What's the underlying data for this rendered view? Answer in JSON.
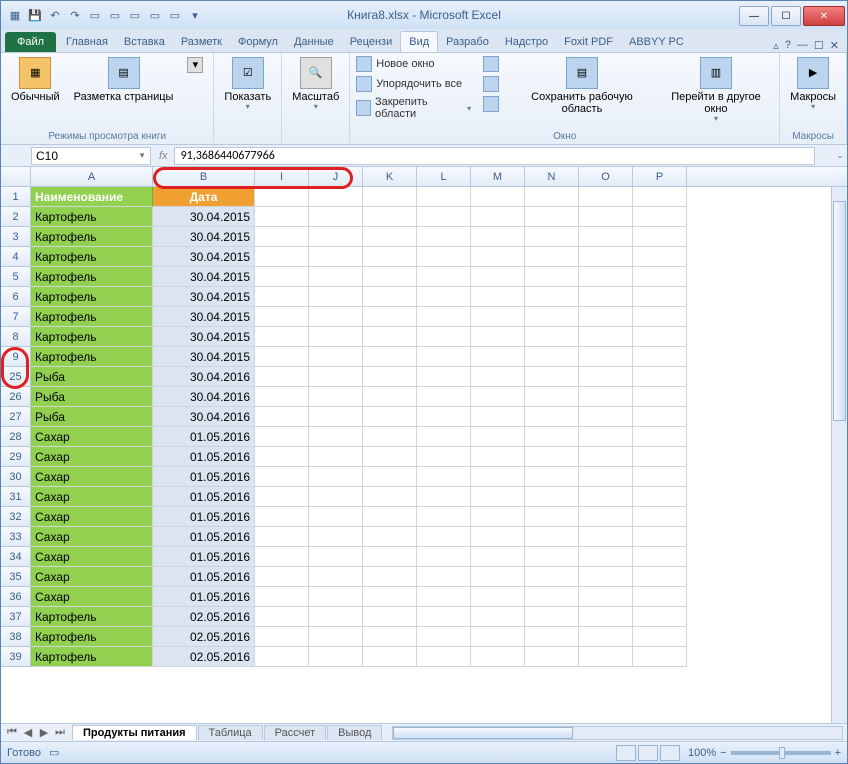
{
  "window": {
    "title": "Книга8.xlsx - Microsoft Excel"
  },
  "tabs": {
    "file": "Файл",
    "items": [
      "Главная",
      "Вставка",
      "Разметк",
      "Формул",
      "Данные",
      "Рецензи",
      "Вид",
      "Разрабо",
      "Надстро",
      "Foxit PDF",
      "ABBYY PC"
    ],
    "active_index": 6
  },
  "ribbon": {
    "group_views": {
      "label": "Режимы просмотра книги",
      "normal": "Обычный",
      "page_layout": "Разметка страницы",
      "more": ""
    },
    "group_show": {
      "btn": "Показать"
    },
    "group_zoom": {
      "btn": "Масштаб"
    },
    "group_window": {
      "label": "Окно",
      "new_window": "Новое окно",
      "arrange": "Упорядочить все",
      "freeze": "Закрепить области",
      "save_ws": "Сохранить рабочую область",
      "switch": "Перейти в другое окно"
    },
    "group_macros": {
      "label": "Макросы",
      "btn": "Макросы"
    }
  },
  "namebox": "C10",
  "formula": "91,3686440677966",
  "grid": {
    "col_widths": {
      "A": 122,
      "B": 102,
      "other": 54
    },
    "visible_cols": [
      "A",
      "B",
      "I",
      "J",
      "K",
      "L",
      "M",
      "N",
      "O",
      "P"
    ],
    "header_row": {
      "A": "Наименование",
      "B": "Дата"
    },
    "rows": [
      {
        "n": 1,
        "A": "Наименование",
        "B": "Дата",
        "is_header": true
      },
      {
        "n": 2,
        "A": "Картофель",
        "B": "30.04.2015"
      },
      {
        "n": 3,
        "A": "Картофель",
        "B": "30.04.2015"
      },
      {
        "n": 4,
        "A": "Картофель",
        "B": "30.04.2015"
      },
      {
        "n": 5,
        "A": "Картофель",
        "B": "30.04.2015"
      },
      {
        "n": 6,
        "A": "Картофель",
        "B": "30.04.2015"
      },
      {
        "n": 7,
        "A": "Картофель",
        "B": "30.04.2015"
      },
      {
        "n": 8,
        "A": "Картофель",
        "B": "30.04.2015"
      },
      {
        "n": 9,
        "A": "Картофель",
        "B": "30.04.2015"
      },
      {
        "n": 25,
        "A": "Рыба",
        "B": "30.04.2016"
      },
      {
        "n": 26,
        "A": "Рыба",
        "B": "30.04.2016"
      },
      {
        "n": 27,
        "A": "Рыба",
        "B": "30.04.2016"
      },
      {
        "n": 28,
        "A": "Сахар",
        "B": "01.05.2016"
      },
      {
        "n": 29,
        "A": "Сахар",
        "B": "01.05.2016"
      },
      {
        "n": 30,
        "A": "Сахар",
        "B": "01.05.2016"
      },
      {
        "n": 31,
        "A": "Сахар",
        "B": "01.05.2016"
      },
      {
        "n": 32,
        "A": "Сахар",
        "B": "01.05.2016"
      },
      {
        "n": 33,
        "A": "Сахар",
        "B": "01.05.2016"
      },
      {
        "n": 34,
        "A": "Сахар",
        "B": "01.05.2016"
      },
      {
        "n": 35,
        "A": "Сахар",
        "B": "01.05.2016"
      },
      {
        "n": 36,
        "A": "Сахар",
        "B": "01.05.2016"
      },
      {
        "n": 37,
        "A": "Картофель",
        "B": "02.05.2016"
      },
      {
        "n": 38,
        "A": "Картофель",
        "B": "02.05.2016"
      },
      {
        "n": 39,
        "A": "Картофель",
        "B": "02.05.2016"
      }
    ]
  },
  "sheets": {
    "items": [
      "Продукты питания",
      "Таблица",
      "Рассчет",
      "Вывод"
    ],
    "active_index": 0
  },
  "status": {
    "ready": "Готово",
    "zoom": "100%"
  }
}
